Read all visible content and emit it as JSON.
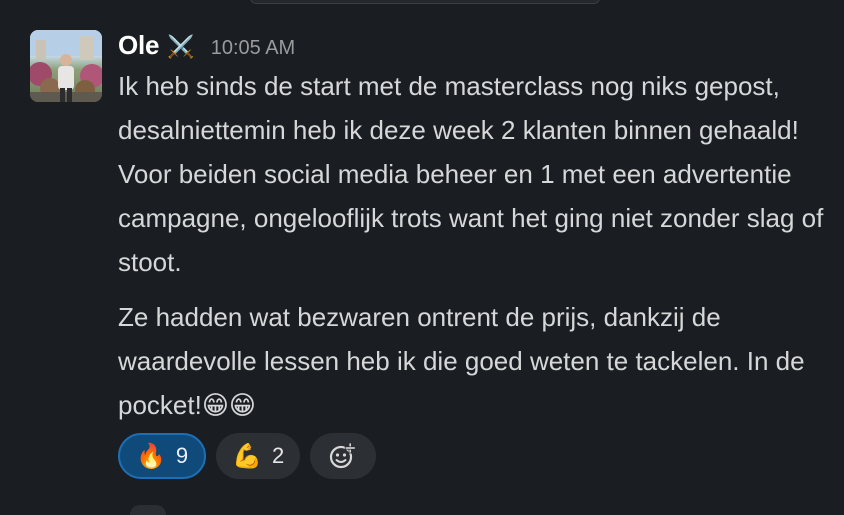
{
  "message": {
    "author": "Ole",
    "author_badge": "⚔️",
    "timestamp": "10:05 AM",
    "paragraph_1": "Ik heb sinds de start met de masterclass nog niks gepost, desalniettemin heb ik deze week 2 klanten binnen gehaald! Voor beiden social media beheer en 1 met een advertentie campagne, ongelooflijk trots want het ging niet zonder slag of stoot.",
    "paragraph_2": "Ze hadden wat bezwaren ontrent de prijs, dankzij de waardevolle lessen heb ik die goed weten te tackelen. In de pocket!",
    "paragraph_2_emojis": "😁😁"
  },
  "reactions": [
    {
      "emoji": "🔥",
      "count": "9",
      "active": true
    },
    {
      "emoji": "💪",
      "count": "2",
      "active": false
    }
  ],
  "add_reaction_icon": "add-reaction-icon",
  "colors": {
    "background": "#1a1d21",
    "active_reaction_bg": "#0f4a7b",
    "active_reaction_border": "#1d6fb5",
    "reaction_bg": "#2c2f33"
  }
}
